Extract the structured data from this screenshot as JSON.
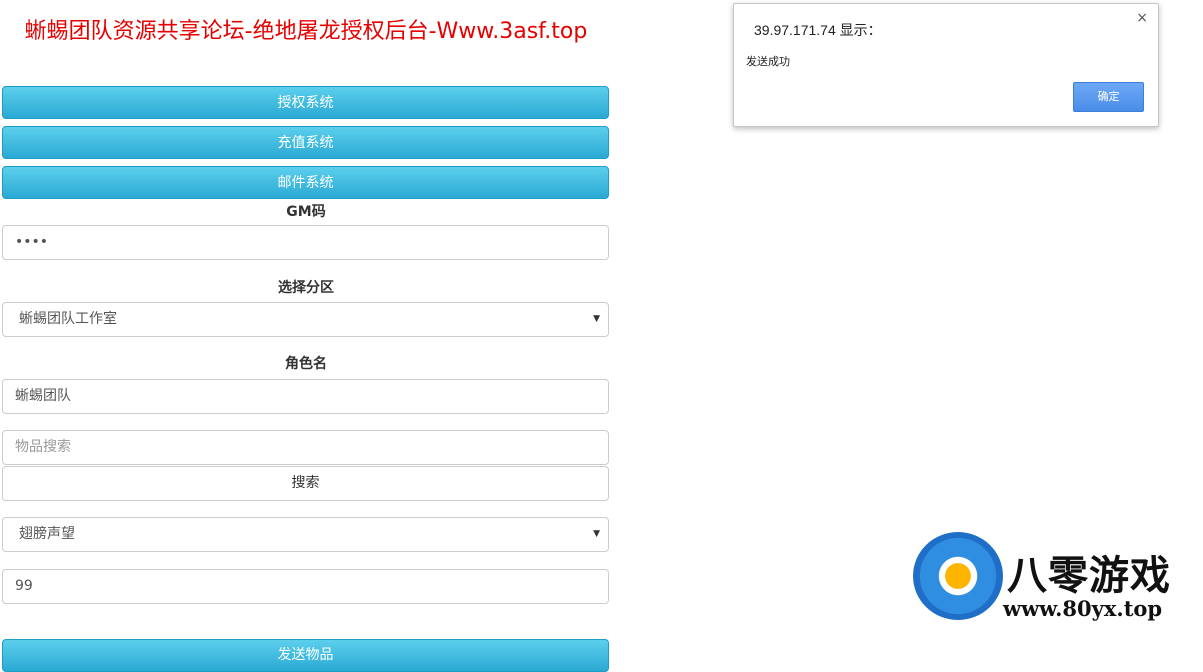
{
  "page": {
    "title": "蜥蜴团队资源共享论坛-绝地屠龙授权后台-Www.3asf.top"
  },
  "nav": {
    "auth": "授权系统",
    "recharge": "充值系统",
    "mail": "邮件系统"
  },
  "form": {
    "gm_label": "GM码",
    "gm_value": "••••",
    "server_label": "选择分区",
    "server_value": "蜥蜴团队工作室",
    "role_label": "角色名",
    "role_value": "蜥蜴团队",
    "item_search_placeholder": "物品搜索",
    "search_button": "搜索",
    "item_value": "翅膀声望",
    "quantity_value": "99",
    "send_button": "发送物品"
  },
  "dialog": {
    "origin": "39.97.171.74 显示：",
    "message": "发送成功",
    "ok": "确定",
    "close": "×"
  },
  "watermark": {
    "brand": "八零游戏",
    "url": "www.80yx.top"
  },
  "icons": {
    "caret": "caret-down-icon",
    "close": "close-icon"
  }
}
